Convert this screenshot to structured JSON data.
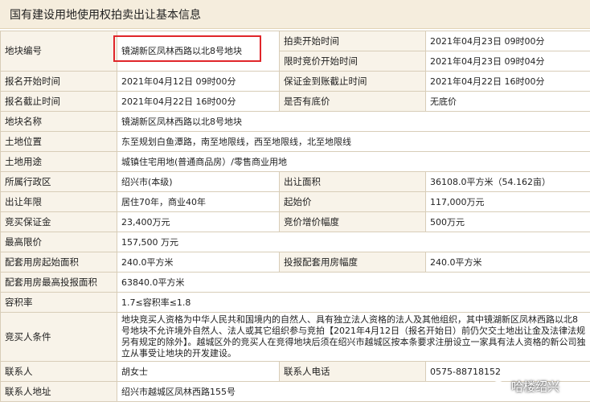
{
  "title": "国有建设用地使用权拍卖出让基本信息",
  "rows": {
    "plot_no": {
      "label": "地块编号",
      "value": "镜湖新区凤林西路以北8号地块"
    },
    "auction_start": {
      "label": "拍卖开始时间",
      "value": "2021年04月23日 09时00分"
    },
    "limited_bid_start": {
      "label": "限时竞价开始时间",
      "value": "2021年04月23日 09时04分"
    },
    "reg_start": {
      "label": "报名开始时间",
      "value": "2021年04月12日 09时00分"
    },
    "deposit_deadline": {
      "label": "保证金到账截止时间",
      "value": "2021年04月22日 16时00分"
    },
    "reg_end": {
      "label": "报名截止时间",
      "value": "2021年04月22日 16时00分"
    },
    "reserve_price": {
      "label": "是否有底价",
      "value": "无底价"
    },
    "plot_name": {
      "label": "地块名称",
      "value": "镜湖新区凤林西路以北8号地块"
    },
    "location": {
      "label": "土地位置",
      "value": "东至规划白鱼潭路，南至地限线，西至地限线，北至地限线"
    },
    "usage": {
      "label": "土地用途",
      "value": "城镇住宅用地(普通商品房）/零售商业用地"
    },
    "district": {
      "label": "所属行政区",
      "value": "绍兴市(本级)"
    },
    "area": {
      "label": "出让面积",
      "value": "36108.0平方米（54.162亩）"
    },
    "term": {
      "label": "出让年限",
      "value": "居住70年，商业40年"
    },
    "start_price": {
      "label": "起始价",
      "value": "117,000万元"
    },
    "bid_deposit": {
      "label": "竞买保证金",
      "value": "23,400万元"
    },
    "increment": {
      "label": "竞价增价幅度",
      "value": "500万元"
    },
    "max_price": {
      "label": "最高限价",
      "value": "157,500 万元"
    },
    "housing_start_area": {
      "label": "配套用房起始面积",
      "value": "240.0平方米"
    },
    "housing_bid_step": {
      "label": "投报配套用房幅度",
      "value": "240.0平方米"
    },
    "housing_max_area": {
      "label": "配套用房最高投报面积",
      "value": "63840.0平方米"
    },
    "far": {
      "label": "容积率",
      "value": "1.7≤容积率≤1.8"
    },
    "conditions": {
      "label": "竞买人条件",
      "value": "地块竞买人资格为中华人民共和国境内的自然人、具有独立法人资格的法人及其他组织，其中镜湖新区凤林西路以北8号地块不允许境外自然人、法人或其它组织参与竞拍【2021年4月12日（报名开始日）前仍欠交土地出让金及法律法规另有规定的除外】。越城区外的竞买人在竞得地块后须在绍兴市越城区按本条要求注册设立一家具有法人资格的新公司独立从事受让地块的开发建设。"
    },
    "contact": {
      "label": "联系人",
      "value": "胡女士"
    },
    "phone": {
      "label": "联系人电话",
      "value": "0575-88718152"
    },
    "address": {
      "label": "联系人地址",
      "value": "绍兴市越城区凤林西路155号"
    }
  },
  "watermark": "哈楼绍兴",
  "colors": {
    "header_bg": "#f5eddd",
    "label_bg": "#f8f3e9",
    "border": "#d8cdb8",
    "highlight": "#e0262a"
  }
}
